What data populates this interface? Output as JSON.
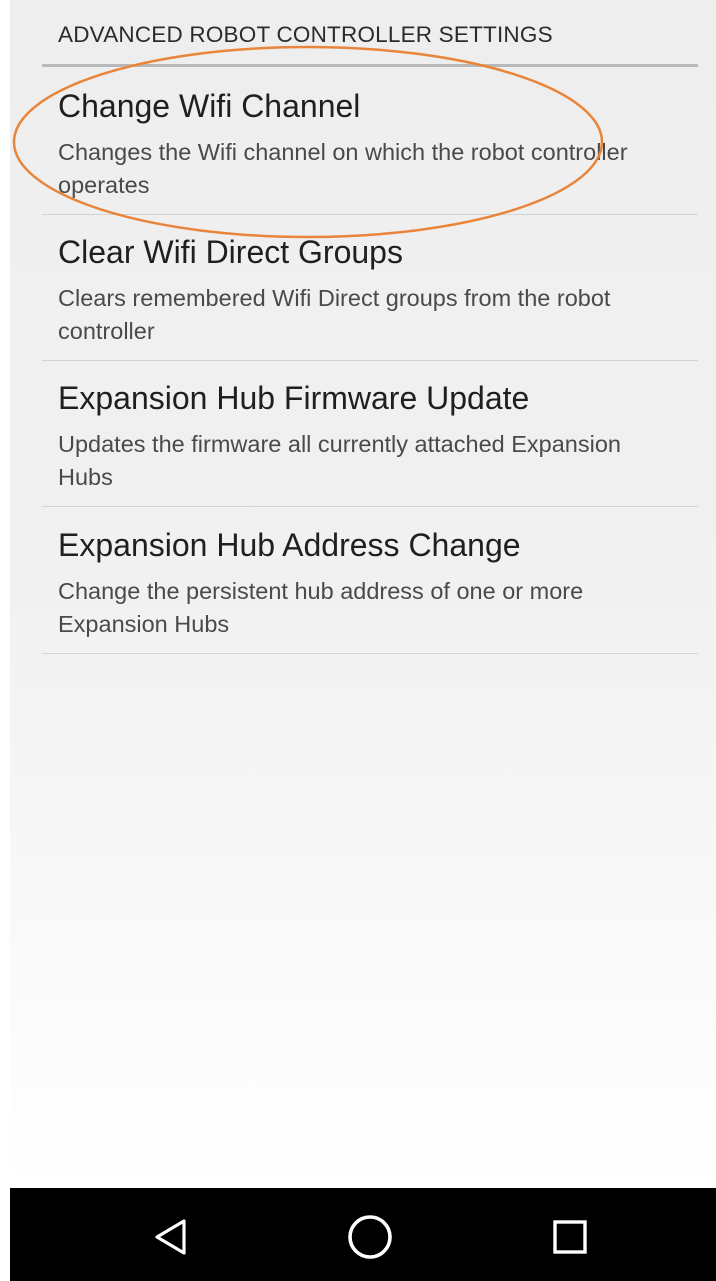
{
  "settings": {
    "category_title": "ADVANCED ROBOT CONTROLLER SETTINGS",
    "items": [
      {
        "title": "Change Wifi Channel",
        "summary": "Changes the Wifi channel on which the robot controller operates"
      },
      {
        "title": "Clear Wifi Direct Groups",
        "summary": "Clears remembered Wifi Direct groups from the robot controller"
      },
      {
        "title": "Expansion Hub Firmware Update",
        "summary": "Updates the firmware all currently attached Expansion Hubs"
      },
      {
        "title": "Expansion Hub Address Change",
        "summary": "Change the persistent hub address of one or more Expansion Hubs"
      }
    ]
  },
  "annotation": {
    "color": "#e8853a"
  },
  "nav_bar": {
    "buttons": [
      {
        "icon": "back-triangle-icon"
      },
      {
        "icon": "home-circle-icon"
      },
      {
        "icon": "recents-square-icon"
      }
    ]
  }
}
